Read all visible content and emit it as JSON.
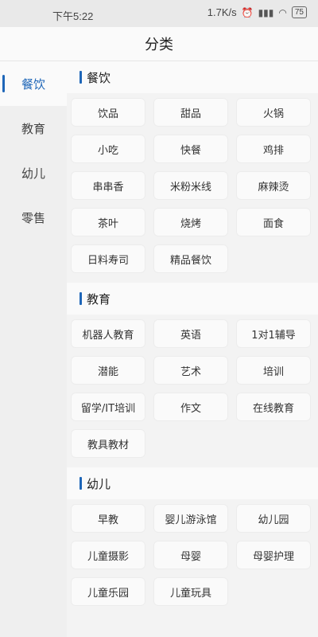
{
  "status": {
    "time": "下午5:22",
    "net_speed": "1.7K/s",
    "battery": "75"
  },
  "header": {
    "title": "分类"
  },
  "sidebar": {
    "items": [
      {
        "label": "餐饮",
        "active": true
      },
      {
        "label": "教育"
      },
      {
        "label": "幼儿"
      },
      {
        "label": "零售"
      }
    ]
  },
  "sections": [
    {
      "title": "餐饮",
      "items": [
        "饮品",
        "甜品",
        "火锅",
        "小吃",
        "快餐",
        "鸡排",
        "串串香",
        "米粉米线",
        "麻辣烫",
        "茶叶",
        "烧烤",
        "面食",
        "日料寿司",
        "精品餐饮"
      ]
    },
    {
      "title": "教育",
      "items": [
        "机器人教育",
        "英语",
        "1对1辅导",
        "潜能",
        "艺术",
        "培训",
        "留学/IT培训",
        "作文",
        "在线教育",
        "教具教材"
      ]
    },
    {
      "title": "幼儿",
      "items": [
        "早教",
        "婴儿游泳馆",
        "幼儿园",
        "儿童摄影",
        "母婴",
        "母婴护理",
        "儿童乐园",
        "儿童玩具"
      ]
    }
  ],
  "colors": {
    "accent": "#1e66b8"
  }
}
